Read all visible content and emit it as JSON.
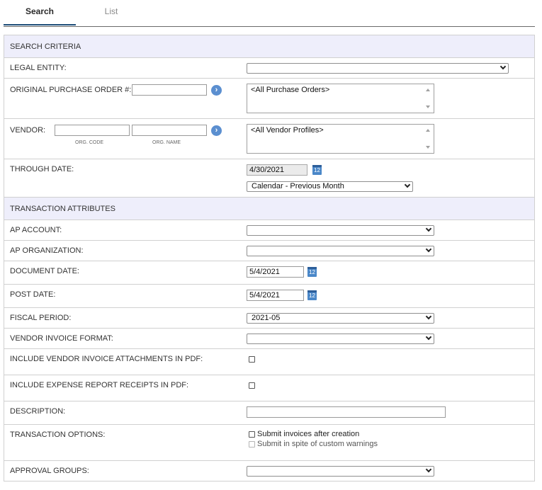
{
  "tabs": {
    "search": "Search",
    "list": "List"
  },
  "sections": {
    "criteria": "SEARCH CRITERIA",
    "attributes": "TRANSACTION ATTRIBUTES"
  },
  "legal_entity": {
    "label": "LEGAL ENTITY:",
    "value": ""
  },
  "original_po": {
    "label": "ORIGINAL PURCHASE ORDER #:",
    "input_value": "",
    "list_value": "<All Purchase Orders>"
  },
  "vendor": {
    "label": "VENDOR:",
    "org_code_label": "ORG. CODE",
    "org_name_label": "ORG. NAME",
    "list_value": "<All Vendor Profiles>"
  },
  "through_date": {
    "label": "THROUGH DATE:",
    "value": "4/30/2021",
    "preset": "Calendar - Previous Month"
  },
  "ap_account": {
    "label": "AP ACCOUNT:",
    "value": ""
  },
  "ap_organization": {
    "label": "AP ORGANIZATION:",
    "value": ""
  },
  "document_date": {
    "label": "DOCUMENT DATE:",
    "value": "5/4/2021"
  },
  "post_date": {
    "label": "POST DATE:",
    "value": "5/4/2021"
  },
  "fiscal_period": {
    "label": "FISCAL PERIOD:",
    "value": "2021-05"
  },
  "vendor_invoice_format": {
    "label": "VENDOR INVOICE FORMAT:",
    "value": ""
  },
  "include_attachments": {
    "label": "INCLUDE VENDOR INVOICE ATTACHMENTS IN PDF:"
  },
  "include_receipts": {
    "label": "INCLUDE EXPENSE REPORT RECEIPTS IN PDF:"
  },
  "description": {
    "label": "DESCRIPTION:",
    "value": ""
  },
  "transaction_options": {
    "label": "TRANSACTION OPTIONS:",
    "submit_after_creation": "Submit invoices after creation",
    "submit_despite_warnings": "Submit in spite of custom warnings"
  },
  "approval_groups": {
    "label": "APPROVAL GROUPS:",
    "value": ""
  },
  "icons": {
    "go": "arrow-right-circle-icon",
    "calendar": "calendar-icon",
    "calendar_text": "12"
  },
  "colors": {
    "section_bg": "#eeeefb",
    "accent": "#1f4e79",
    "go_button": "#5b8fd0",
    "calendar": "#4a87c8"
  }
}
